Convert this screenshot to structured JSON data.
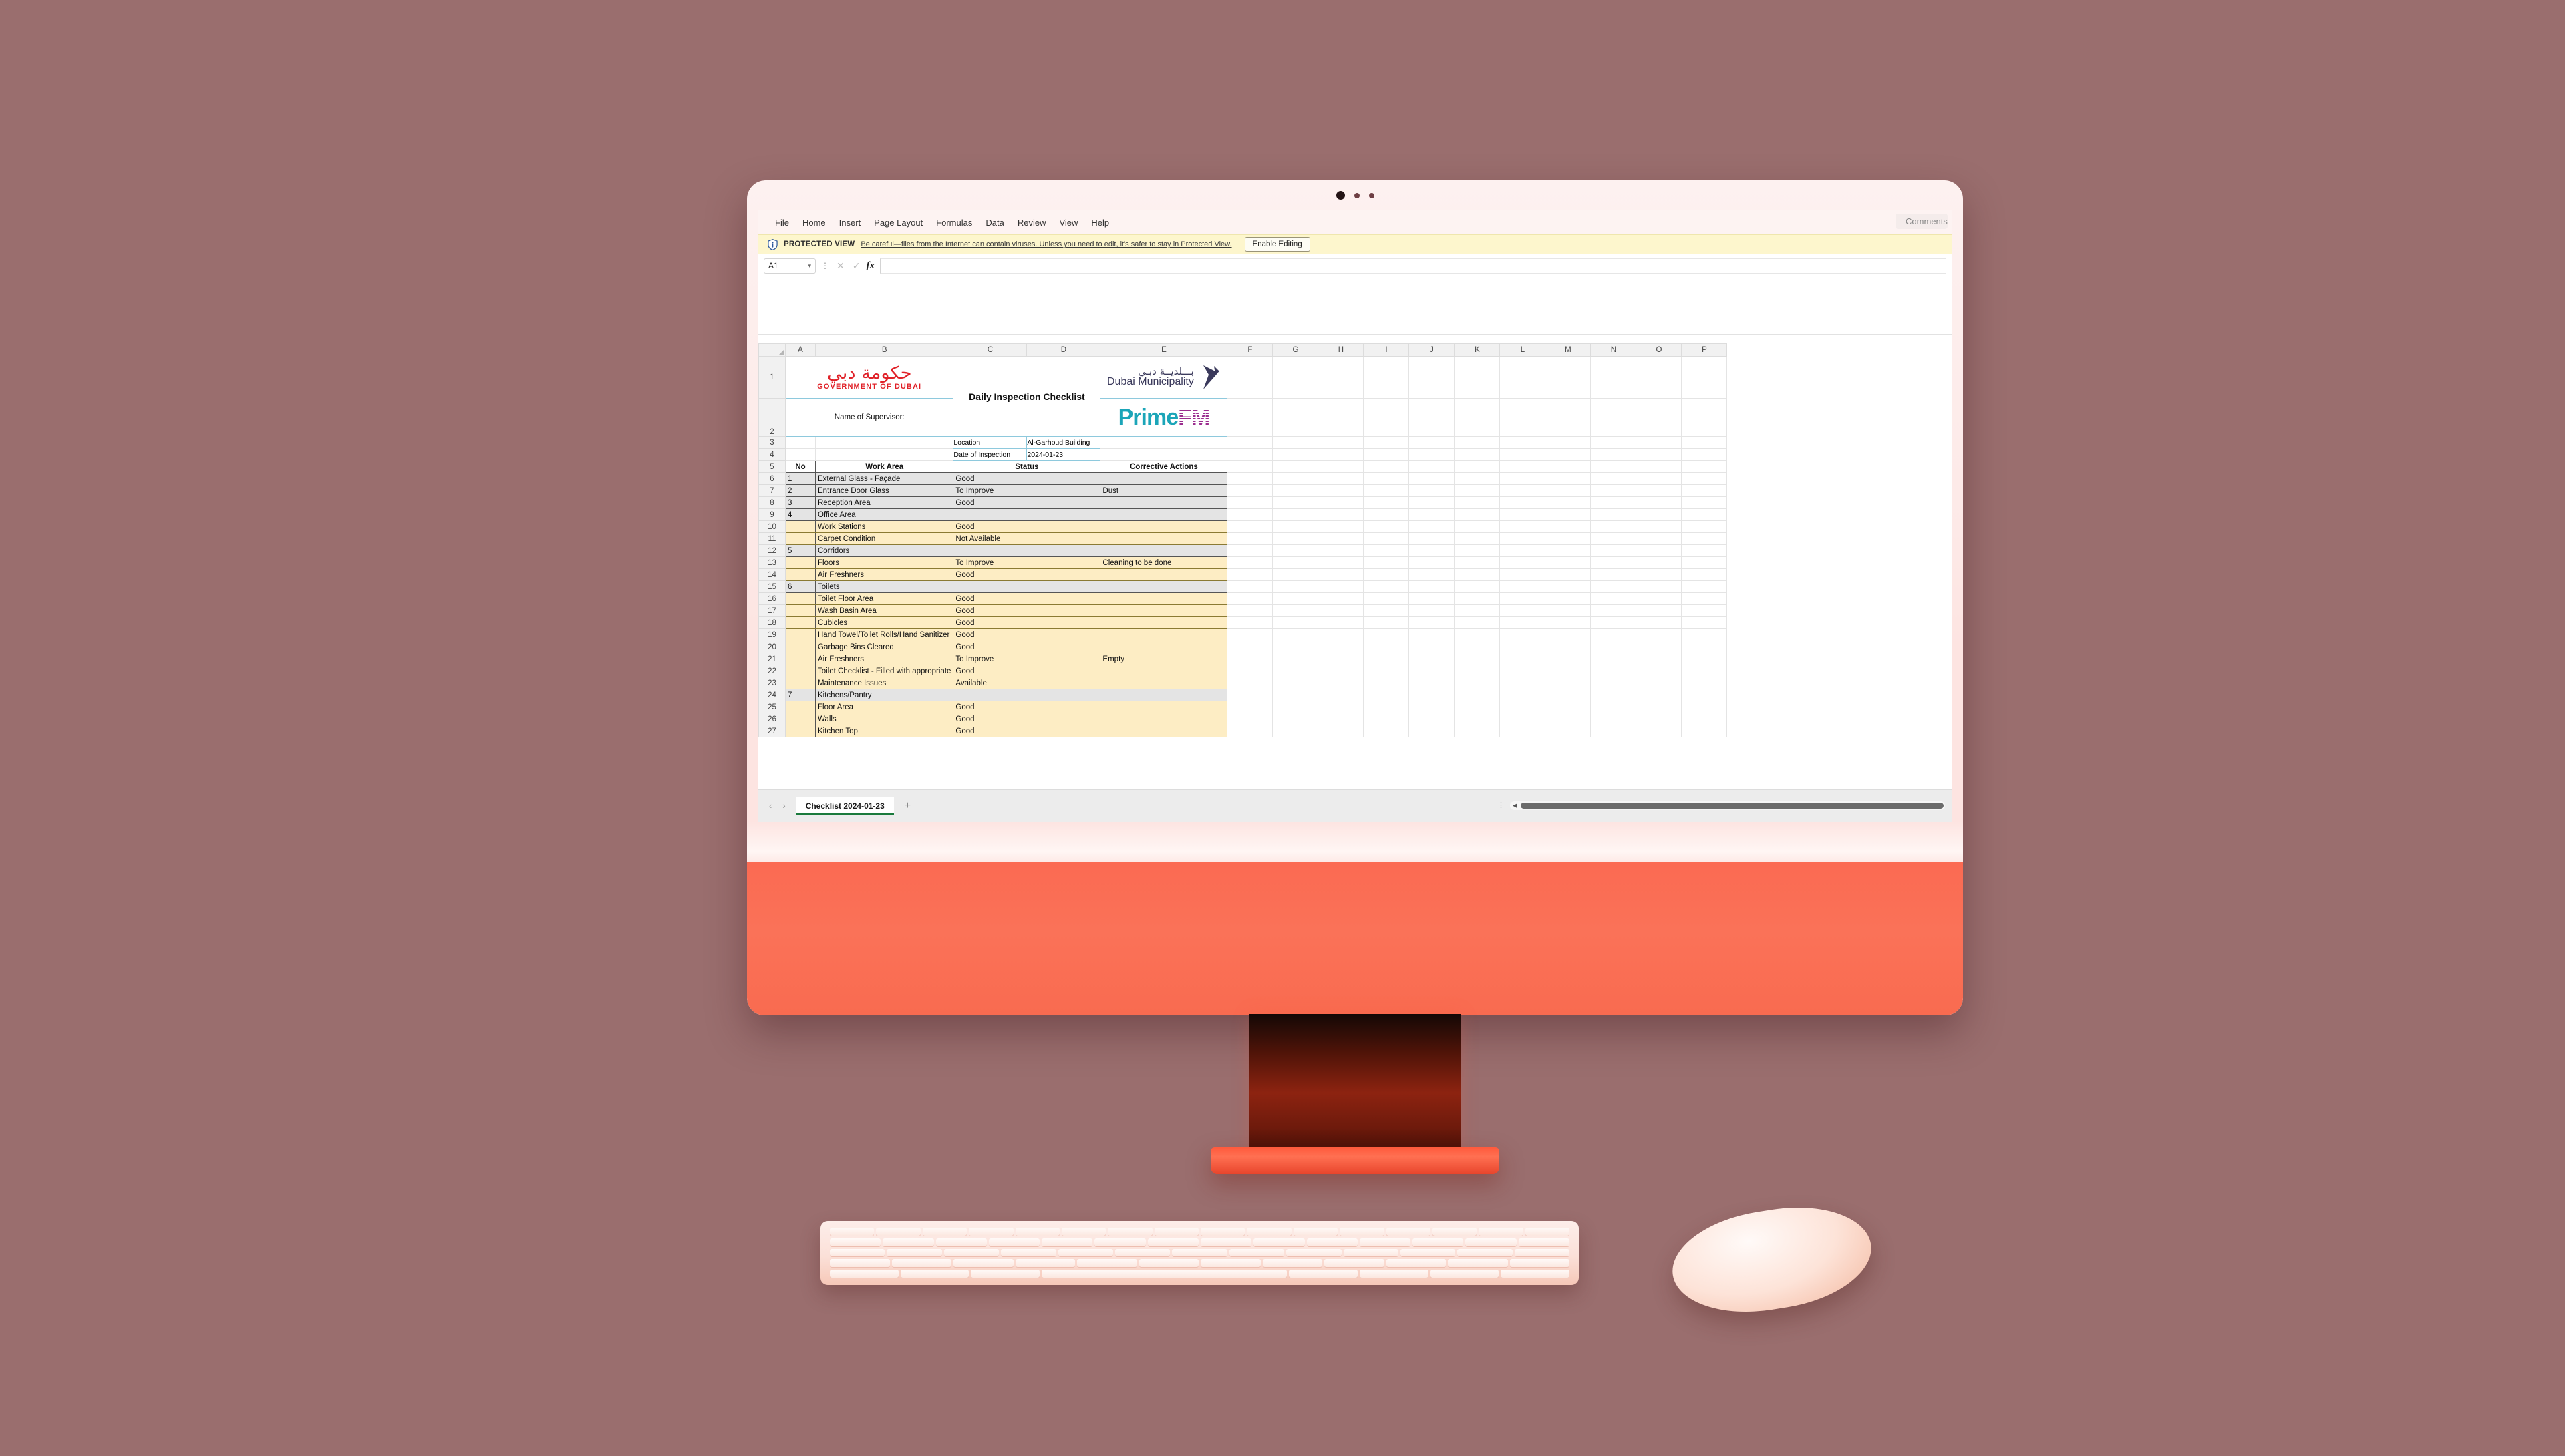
{
  "app": {
    "ribbon_tabs": [
      "File",
      "Home",
      "Insert",
      "Page Layout",
      "Formulas",
      "Data",
      "Review",
      "View",
      "Help"
    ],
    "comments_label": "Comments"
  },
  "protected_view": {
    "title": "PROTECTED VIEW",
    "message": "Be careful—files from the Internet can contain viruses. Unless you need to edit, it's safer to stay in Protected View.",
    "enable_button": "Enable Editing"
  },
  "formula_bar": {
    "name_box": "A1",
    "formula_value": "",
    "cancel_icon": "✕",
    "confirm_icon": "✓",
    "function_icon": "fx"
  },
  "grid": {
    "column_headers": [
      "A",
      "B",
      "C",
      "D",
      "E",
      "F",
      "G",
      "H",
      "I",
      "J",
      "K",
      "L",
      "M",
      "N",
      "O",
      "P"
    ],
    "row_numbers": [
      1,
      2,
      3,
      4,
      5,
      6,
      7,
      8,
      9,
      10,
      11,
      12,
      13,
      14,
      15,
      16,
      17,
      18,
      19,
      20,
      21,
      22,
      23,
      24,
      25,
      26,
      27
    ]
  },
  "document": {
    "gov_logo": {
      "arabic": "حكومة دبي",
      "english": "GOVERNMENT OF DUBAI"
    },
    "municipality_logo": {
      "arabic": "بـــلديــة دبـي",
      "english": "Dubai Municipality"
    },
    "prime_fm_logo": {
      "part1": "Prime",
      "part2": "FM"
    },
    "title": "Daily Inspection Checklist",
    "supervisor_label": "Name of Supervisor:",
    "supervisor_value": "",
    "info": [
      {
        "label": "Location",
        "value": "Al-Garhoud Building"
      },
      {
        "label": "Date of Inspection",
        "value": "2024-01-23"
      }
    ],
    "table_headers": [
      "No",
      "Work Area",
      "Status",
      "Corrective Actions"
    ],
    "rows": [
      {
        "row": 6,
        "type": "section",
        "no": "1",
        "area": "External Glass - Façade",
        "status": "Good",
        "action": ""
      },
      {
        "row": 7,
        "type": "section",
        "no": "2",
        "area": "Entrance Door Glass",
        "status": "To Improve",
        "action": "Dust"
      },
      {
        "row": 8,
        "type": "section",
        "no": "3",
        "area": "Reception Area",
        "status": "Good",
        "action": ""
      },
      {
        "row": 9,
        "type": "section",
        "no": "4",
        "area": "Office Area",
        "status": "",
        "action": ""
      },
      {
        "row": 10,
        "type": "item",
        "no": "",
        "area": "Work Stations",
        "status": "Good",
        "action": ""
      },
      {
        "row": 11,
        "type": "item",
        "no": "",
        "area": "Carpet Condition",
        "status": "Not Available",
        "action": ""
      },
      {
        "row": 12,
        "type": "section",
        "no": "5",
        "area": "Corridors",
        "status": "",
        "action": ""
      },
      {
        "row": 13,
        "type": "item",
        "no": "",
        "area": "Floors",
        "status": "To Improve",
        "action": "Cleaning to be done"
      },
      {
        "row": 14,
        "type": "item",
        "no": "",
        "area": "Air Freshners",
        "status": "Good",
        "action": ""
      },
      {
        "row": 15,
        "type": "section",
        "no": "6",
        "area": "Toilets",
        "status": "",
        "action": ""
      },
      {
        "row": 16,
        "type": "item",
        "no": "",
        "area": "Toilet Floor Area",
        "status": "Good",
        "action": ""
      },
      {
        "row": 17,
        "type": "item",
        "no": "",
        "area": "Wash Basin Area",
        "status": "Good",
        "action": ""
      },
      {
        "row": 18,
        "type": "item",
        "no": "",
        "area": "Cubicles",
        "status": "Good",
        "action": ""
      },
      {
        "row": 19,
        "type": "item",
        "no": "",
        "area": "Hand Towel/Toilet Rolls/Hand Sanitizer",
        "status": "Good",
        "action": ""
      },
      {
        "row": 20,
        "type": "item",
        "no": "",
        "area": "Garbage Bins Cleared",
        "status": "Good",
        "action": ""
      },
      {
        "row": 21,
        "type": "item",
        "no": "",
        "area": "Air Freshners",
        "status": "To Improve",
        "action": "Empty"
      },
      {
        "row": 22,
        "type": "item",
        "no": "",
        "area": "Toilet Checklist - Filled with appropriate",
        "status": "Good",
        "action": ""
      },
      {
        "row": 23,
        "type": "item",
        "no": "",
        "area": "Maintenance Issues",
        "status": "Available",
        "action": ""
      },
      {
        "row": 24,
        "type": "section",
        "no": "7",
        "area": "Kitchens/Pantry",
        "status": "",
        "action": ""
      },
      {
        "row": 25,
        "type": "item",
        "no": "",
        "area": "Floor Area",
        "status": "Good",
        "action": ""
      },
      {
        "row": 26,
        "type": "item",
        "no": "",
        "area": "Walls",
        "status": "Good",
        "action": ""
      },
      {
        "row": 27,
        "type": "item",
        "no": "",
        "area": "Kitchen Top",
        "status": "Good",
        "action": ""
      }
    ]
  },
  "sheet_bar": {
    "prev_icon": "‹",
    "next_icon": "›",
    "tab_name": "Checklist 2024-01-23",
    "add_sheet_icon": "+"
  },
  "colors": {
    "desktop_background": "#9a6e6e",
    "imac_chin": "#fa7258",
    "section_row": "#e4e4e4",
    "item_row": "#fdedc4",
    "protected_banner": "#fdf6cd",
    "sheet_tab_accent": "#1a7a3c",
    "gov_logo_red": "#e02128",
    "municipality_navy": "#3b3a5c",
    "prime_teal": "#1ba5b8",
    "fm_purple": "#9b2d8f"
  }
}
